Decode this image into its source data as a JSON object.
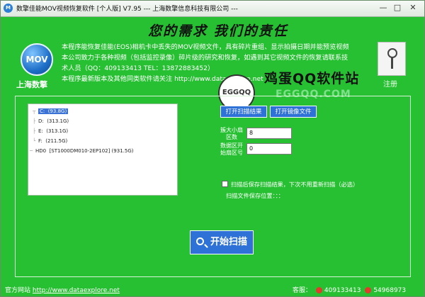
{
  "window": {
    "title": "数擎佳能MOV视频恢复软件   [个人版]    V7.95   ---  上海数擎信息科技有限公司  ---",
    "minimize": "—",
    "maximize": "□",
    "close": "✕"
  },
  "header": {
    "slogan": "您的需求   我们的责任",
    "logo_text": "MOV",
    "company": "上海数擎",
    "desc_lines": [
      "本程序能恢复佳能(EOS)相机卡中丢失的MOV视频文件，具有碎片重组、显示拍摄日期并能预览视频",
      "本公司致力于各种视频（包括监控录像）碎片级的研究和恢复，如遇到其它视频文件的恢复请联系技",
      "术人员（QQ：409133413  TEL：13872883452）",
      "本程序最新版本及其他同类软件请关注 http://www.dataexplore.net"
    ],
    "register_label": "注册"
  },
  "watermark": {
    "circle_text": "EGGQQ",
    "title": "鸡蛋QQ软件站",
    "url": "EGGQQ.COM"
  },
  "drives": [
    {
      "name": "C:",
      "size": "(93.8G)"
    },
    {
      "name": "D:",
      "size": "(313.1G)"
    },
    {
      "name": "E:",
      "size": "(313.1G)"
    },
    {
      "name": "F:",
      "size": "(211.5G)"
    },
    {
      "name": "HD0",
      "size": "[ST1000DM010-2EP102]   (931.5G)"
    }
  ],
  "buttons": {
    "open_scan_result": "打开扫描结果",
    "open_image_file": "打开镜像文件",
    "start_scan": "开始扫描"
  },
  "fields": {
    "max_sectors_label": "簇大小扇区数",
    "max_sectors_value": "8",
    "data_start_label": "数据区开始扇区号",
    "data_start_value": "0"
  },
  "options": {
    "save_checkbox_label": "扫描后保存扫描结果，下次不用重新扫描（必选）",
    "save_position": "扫描文件保存位置：：："
  },
  "footer": {
    "site_label": "官方网站",
    "site_url": "http://www.dataexplore.net",
    "support_label": "客服：",
    "qq1": "409133413",
    "qq2": "54968973"
  }
}
